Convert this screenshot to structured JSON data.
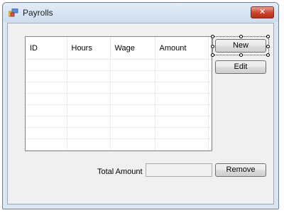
{
  "window": {
    "title": "Payrolls",
    "close_glyph": "✕",
    "icon": "app-window-icon"
  },
  "grid": {
    "columns": [
      "ID",
      "Hours",
      "Wage",
      "Amount"
    ],
    "rows": [
      [],
      [],
      [],
      [],
      [],
      [],
      [],
      []
    ]
  },
  "buttons": {
    "new_label": "New",
    "edit_label": "Edit",
    "remove_label": "Remove"
  },
  "total": {
    "label": "Total Amount",
    "value": ""
  },
  "colors": {
    "accent_close": "#c8432c",
    "client_bg": "#f0f0f0",
    "title_bg": "#dbe6f3"
  }
}
